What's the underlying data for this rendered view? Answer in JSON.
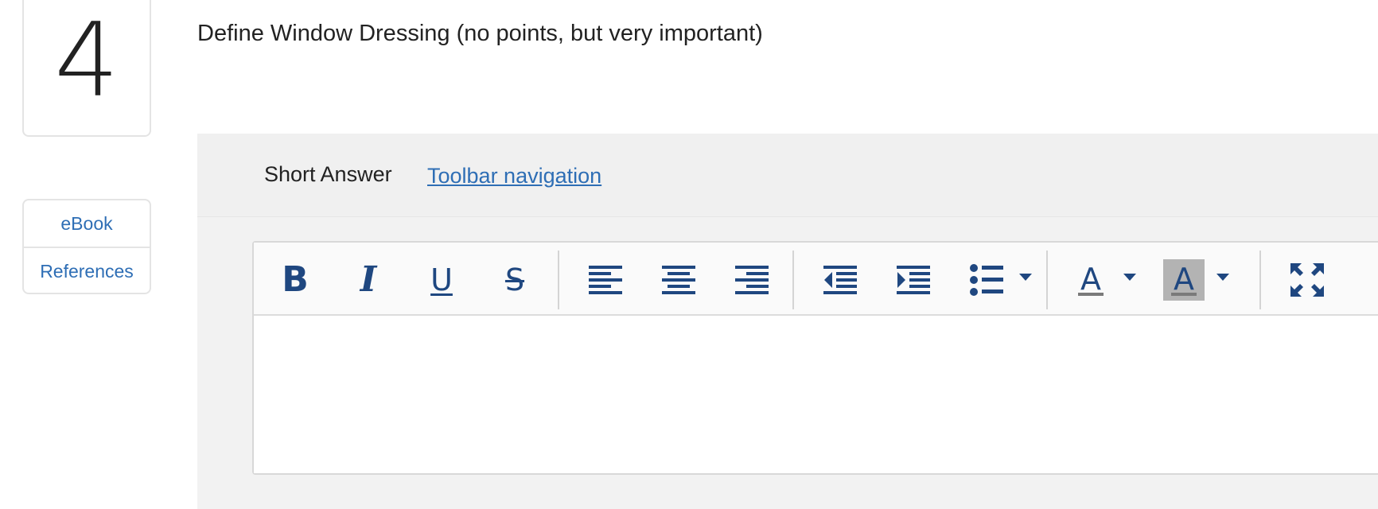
{
  "question": {
    "number": "4",
    "text": "Define Window Dressing (no points, but very important)"
  },
  "side_links": {
    "ebook": "eBook",
    "references": "References"
  },
  "answer": {
    "type_label": "Short Answer",
    "toolbar_nav_link": "Toolbar navigation ",
    "content": ""
  },
  "toolbar": {
    "bold_glyph": "B",
    "italic_glyph": "I",
    "underline_glyph": "U",
    "strike_glyph": "S",
    "text_color_glyph": "A",
    "bg_color_glyph": "A",
    "icons": [
      "bold-icon",
      "italic-icon",
      "underline-icon",
      "strikethrough-icon",
      "align-left-icon",
      "align-center-icon",
      "align-right-icon",
      "outdent-icon",
      "indent-icon",
      "bullet-list-icon",
      "text-color-icon",
      "background-color-icon",
      "fullscreen-icon"
    ]
  },
  "colors": {
    "accent_link": "#2e6eb5",
    "icon_blue": "#1f4780",
    "panel_bg": "#f2f2f2",
    "highlight_gray": "#b3b3b3"
  }
}
